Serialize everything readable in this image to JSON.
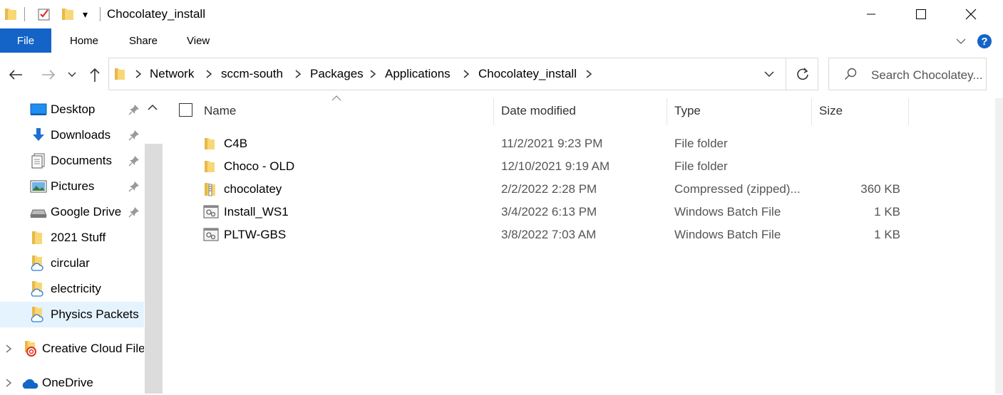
{
  "window": {
    "title": "Chocolatey_install",
    "dropdown_glyph": "▾"
  },
  "ribbon": {
    "tabs": [
      "File",
      "Home",
      "Share",
      "View"
    ]
  },
  "address": {
    "crumbs": [
      "Network",
      "sccm-south",
      "Packages",
      "Applications",
      "Chocolatey_install"
    ]
  },
  "search": {
    "placeholder": "Search Chocolatey..."
  },
  "nav": {
    "quick_access": [
      {
        "label": "Desktop",
        "icon": "desktop-icon",
        "pinned": true
      },
      {
        "label": "Downloads",
        "icon": "download-arrow-icon",
        "pinned": true
      },
      {
        "label": "Documents",
        "icon": "documents-icon",
        "pinned": true
      },
      {
        "label": "Pictures",
        "icon": "pictures-icon",
        "pinned": true
      },
      {
        "label": "Google Drive",
        "icon": "drive-icon",
        "pinned": true
      },
      {
        "label": "2021 Stuff",
        "icon": "folder-icon",
        "pinned": false
      },
      {
        "label": "circular",
        "icon": "cloud-folder-icon",
        "pinned": false
      },
      {
        "label": "electricity",
        "icon": "cloud-folder-icon",
        "pinned": false
      },
      {
        "label": "Physics Packets",
        "icon": "cloud-folder-icon",
        "pinned": false
      }
    ],
    "roots": [
      {
        "label": "Creative Cloud File",
        "icon": "creative-cloud-icon"
      },
      {
        "label": "OneDrive",
        "icon": "onedrive-icon"
      }
    ]
  },
  "columns": {
    "name": "Name",
    "date": "Date modified",
    "type": "Type",
    "size": "Size"
  },
  "files": [
    {
      "name": "C4B",
      "date": "11/2/2021 9:23 PM",
      "type": "File folder",
      "size": "",
      "icon": "folder-icon"
    },
    {
      "name": "Choco - OLD",
      "date": "12/10/2021 9:19 AM",
      "type": "File folder",
      "size": "",
      "icon": "folder-icon"
    },
    {
      "name": "chocolatey",
      "date": "2/2/2022 2:28 PM",
      "type": "Compressed (zipped)...",
      "size": "360 KB",
      "icon": "zip-folder-icon"
    },
    {
      "name": "Install_WS1",
      "date": "3/4/2022 6:13 PM",
      "type": "Windows Batch File",
      "size": "1 KB",
      "icon": "batch-file-icon"
    },
    {
      "name": "PLTW-GBS",
      "date": "3/8/2022 7:03 AM",
      "type": "Windows Batch File",
      "size": "1 KB",
      "icon": "batch-file-icon"
    }
  ],
  "colors": {
    "file_tab": "#1464c8",
    "folder": "#f8d775",
    "selection": "#e5f3ff",
    "help": "#1464c8"
  }
}
